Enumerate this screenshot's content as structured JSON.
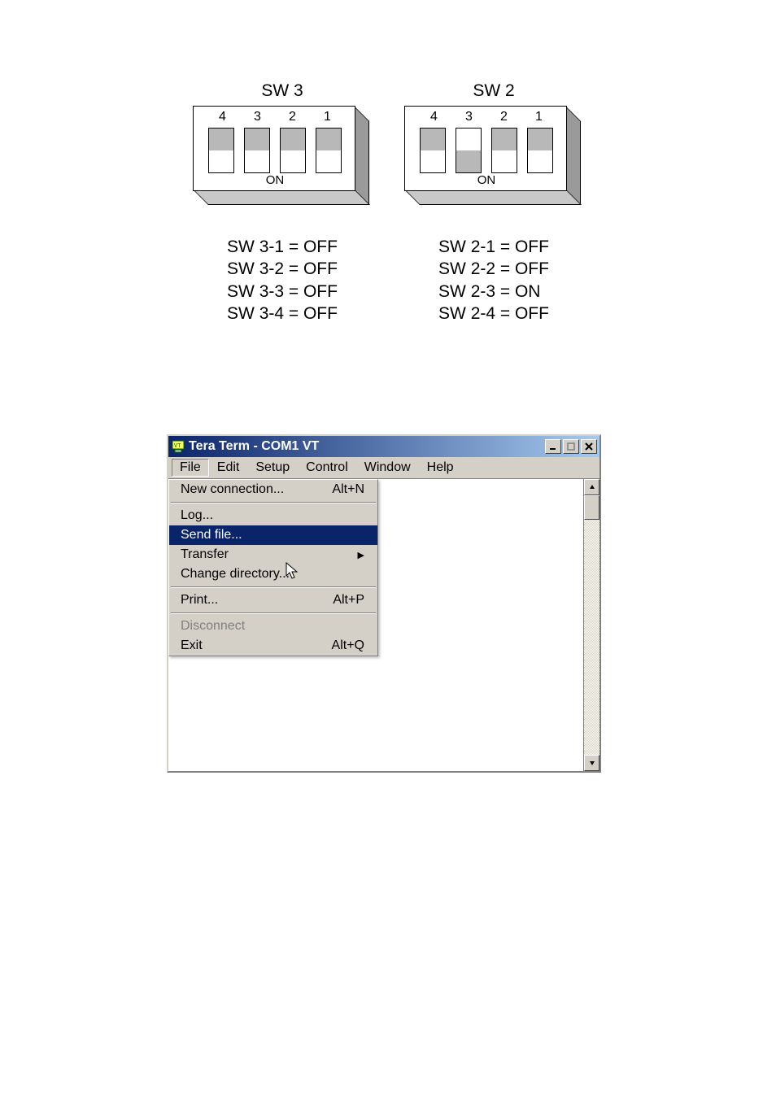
{
  "dip": {
    "sw3": {
      "title": "SW 3",
      "numbers": [
        "4",
        "3",
        "2",
        "1"
      ],
      "positions": [
        "up",
        "up",
        "up",
        "up"
      ],
      "on_label": "ON",
      "states": [
        "SW 3-1 = OFF",
        "SW 3-2 = OFF",
        "SW 3-3 = OFF",
        "SW 3-4 = OFF"
      ]
    },
    "sw2": {
      "title": "SW 2",
      "numbers": [
        "4",
        "3",
        "2",
        "1"
      ],
      "positions": [
        "up",
        "down",
        "up",
        "up"
      ],
      "on_label": "ON",
      "states": [
        "SW 2-1 = OFF",
        "SW 2-2 = OFF",
        "SW 2-3 = ON",
        "SW 2-4 = OFF"
      ]
    }
  },
  "window": {
    "title": "Tera Term - COM1 VT",
    "menus": [
      "File",
      "Edit",
      "Setup",
      "Control",
      "Window",
      "Help"
    ],
    "file_menu": {
      "new_connection": {
        "label": "New connection...",
        "shortcut": "Alt+N"
      },
      "log": {
        "label": "Log..."
      },
      "send_file": {
        "label": "Send file..."
      },
      "transfer": {
        "label": "Transfer"
      },
      "change_dir": {
        "label": "Change directory..."
      },
      "print": {
        "label": "Print...",
        "shortcut": "Alt+P"
      },
      "disconnect": {
        "label": "Disconnect"
      },
      "exit": {
        "label": "Exit",
        "shortcut": "Alt+Q"
      }
    }
  }
}
